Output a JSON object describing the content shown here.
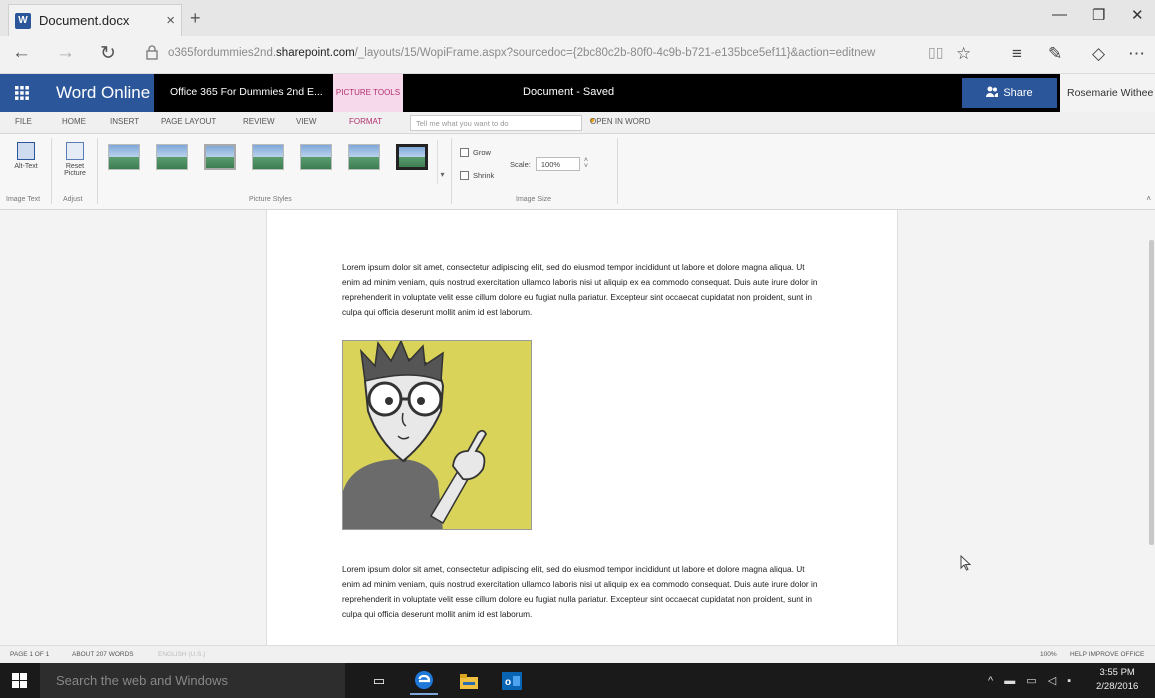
{
  "browser": {
    "tab_title": "Document.docx",
    "tab_close": "×",
    "new_tab": "+",
    "window_controls": [
      "—",
      "❐",
      "✕"
    ],
    "nav": {
      "back": "←",
      "forward": "→",
      "refresh": "↻",
      "lock": "🔒"
    },
    "url_prefix": "o365fordummies2nd.",
    "url_domain": "sharepoint.com",
    "url_rest": "/_layouts/15/WopiFrame.aspx?sourcedoc={2bc80c2b-80f0-4c9b-b721-e135bce5ef11}&action=editnew"
  },
  "word_header": {
    "app_name": "Word Online",
    "doc_title": "Office 365 For Dummies 2nd E...",
    "context_tab": "PICTURE TOOLS",
    "status": "Document  -  Saved",
    "share_label": "Share",
    "user_name": "Rosemarie Withee"
  },
  "ribbon_tabs": [
    "FILE",
    "HOME",
    "INSERT",
    "PAGE LAYOUT",
    "REVIEW",
    "VIEW",
    "FORMAT"
  ],
  "tell_me_placeholder": "Tell me what you want to do",
  "open_in_word": "OPEN IN WORD",
  "ribbon": {
    "alt_text": "Alt-Text",
    "reset_picture": [
      "Reset",
      "Picture"
    ],
    "grow": "Grow",
    "shrink": "Shrink",
    "scale_label": "Scale:",
    "scale_value": "100%",
    "groups": [
      "Image Text",
      "Adjust",
      "Picture Styles",
      "Image Size"
    ]
  },
  "document": {
    "paragraph_1": "Lorem ipsum dolor sit amet, consectetur adipiscing elit, sed do eiusmod tempor incididunt ut labore et dolore magna aliqua. Ut enim ad minim veniam, quis nostrud exercitation ullamco laboris nisi ut aliquip ex ea commodo consequat. Duis aute irure dolor in reprehenderit in voluptate velit esse cillum dolore eu fugiat nulla pariatur. Excepteur sint occaecat cupidatat non proident, sunt in culpa qui officia deserunt mollit anim id est laborum.",
    "paragraph_2": "Lorem ipsum dolor sit amet, consectetur adipiscing elit, sed do eiusmod tempor incididunt ut labore et dolore magna aliqua. Ut enim ad minim veniam, quis nostrud exercitation ullamco laboris nisi ut aliquip ex ea commodo consequat. Duis aute irure dolor in reprehenderit in voluptate velit esse cillum dolore eu fugiat nulla pariatur. Excepteur sint occaecat cupidatat non proident, sunt in culpa qui officia deserunt mollit anim id est laborum."
  },
  "status_bar": {
    "page": "PAGE 1 OF 1",
    "words": "ABOUT 207 WORDS",
    "language": "ENGLISH (U.S.)",
    "zoom": "100%",
    "help": "HELP IMPROVE OFFICE"
  },
  "taskbar": {
    "search_placeholder": "Search the web and Windows",
    "time": "3:55 PM",
    "date": "2/28/2016"
  },
  "colors": {
    "word_blue": "#2b579a",
    "format_pink": "#b0306e",
    "picture_bg": "#d9d35a"
  }
}
